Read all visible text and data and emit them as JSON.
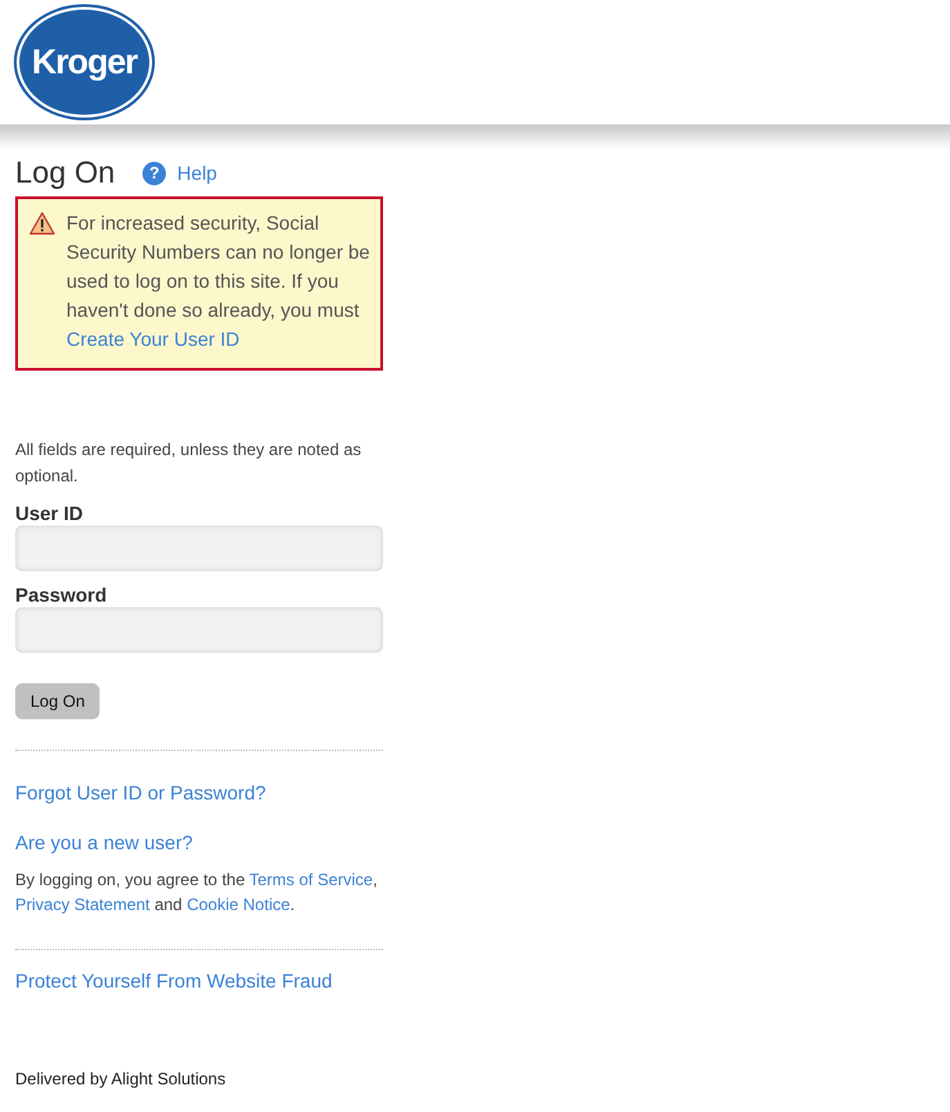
{
  "logo": {
    "text": "Kroger"
  },
  "title": "Log On",
  "help": {
    "label": "Help",
    "icon_text": "?"
  },
  "alert": {
    "text": "For increased security, Social Security Numbers can no longer be used to log on to this site. If you haven't done so already, you must",
    "link": "Create Your User ID"
  },
  "instructions": "All fields are required, unless they are noted as optional.",
  "fields": [
    {
      "label": "User ID"
    },
    {
      "label": "Password"
    }
  ],
  "submit": "Log On",
  "links": [
    "Forgot User ID or Password?",
    "Are you a new user?"
  ],
  "agreement": [
    {
      "kind": "text",
      "text": "By logging on, you agree to the "
    },
    {
      "kind": "link",
      "text": "Terms of Service"
    },
    {
      "kind": "text",
      "text": ", "
    },
    {
      "kind": "link",
      "text": "Privacy Statement"
    },
    {
      "kind": "text",
      "text": " and "
    },
    {
      "kind": "link",
      "text": "Cookie Notice"
    },
    {
      "kind": "text",
      "text": "."
    }
  ],
  "fraud_link": "Protect Yourself From Website Fraud",
  "footer": "Delivered by Alight Solutions"
}
